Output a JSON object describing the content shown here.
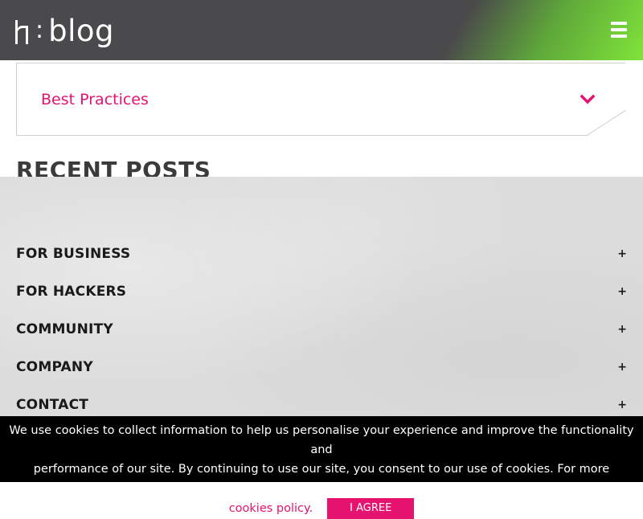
{
  "header": {
    "logo_colon": ":",
    "logo_text": "blog",
    "menu_icon": "hamburger-menu-icon",
    "colors": {
      "dark": "#4a494b",
      "green": "#7fe43a"
    }
  },
  "category": {
    "selected": "Best Practices",
    "chevron_icon": "chevron-down-icon",
    "color": "#e5136f"
  },
  "recent_posts_heading": "RECENT POSTS",
  "footer": {
    "items": [
      {
        "label": "FOR BUSINESS",
        "icon": "+"
      },
      {
        "label": "FOR HACKERS",
        "icon": "+"
      },
      {
        "label": "COMMUNITY",
        "icon": "+"
      },
      {
        "label": "COMPANY",
        "icon": "+"
      },
      {
        "label": "CONTACT",
        "icon": "+"
      }
    ]
  },
  "cookie_banner": {
    "text_line1": "We use cookies to collect information to help us personalise your experience and improve the functionality and",
    "text_line2": "performance of our site. By continuing to use our site, you consent to our use of cookies. For more information see our",
    "link_text": "cookies policy.",
    "button_label": "I AGREE",
    "accent": "#e5136f"
  }
}
